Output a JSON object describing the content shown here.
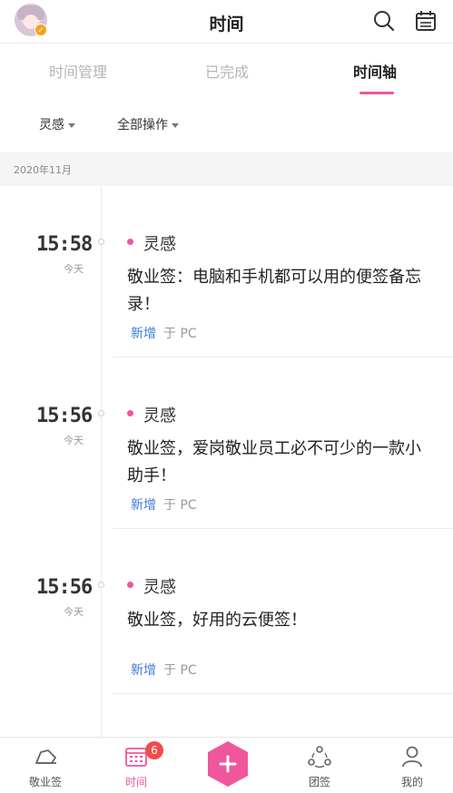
{
  "header": {
    "title": "时间"
  },
  "tabs": [
    {
      "label": "时间管理"
    },
    {
      "label": "已完成"
    },
    {
      "label": "时间轴"
    }
  ],
  "filters": {
    "tag": "灵感",
    "bulk": "全部操作"
  },
  "month_label": "2020年11月",
  "entries": [
    {
      "time": "15:58",
      "day": "今天",
      "tag": "灵感",
      "note": "敬业签：电脑和手机都可以用的便签备忘录！",
      "action": "新增",
      "source": "于 PC"
    },
    {
      "time": "15:56",
      "day": "今天",
      "tag": "灵感",
      "note": "敬业签，爱岗敬业员工必不可少的一款小助手！",
      "action": "新增",
      "source": "于 PC"
    },
    {
      "time": "15:56",
      "day": "今天",
      "tag": "灵感",
      "note": "敬业签，好用的云便签！",
      "action": "新增",
      "source": "于 PC"
    }
  ],
  "bottom_nav": {
    "items": [
      {
        "label": "敬业签",
        "icon": "cloud-note-icon"
      },
      {
        "label": "时间",
        "icon": "calendar-grid-icon",
        "badge": "6"
      },
      {
        "label": "",
        "icon": "plus-icon"
      },
      {
        "label": "团签",
        "icon": "team-icon"
      },
      {
        "label": "我的",
        "icon": "person-icon"
      }
    ]
  },
  "colors": {
    "accent": "#f0569c",
    "link": "#3b7bd4",
    "badge": "#f24b4b"
  }
}
